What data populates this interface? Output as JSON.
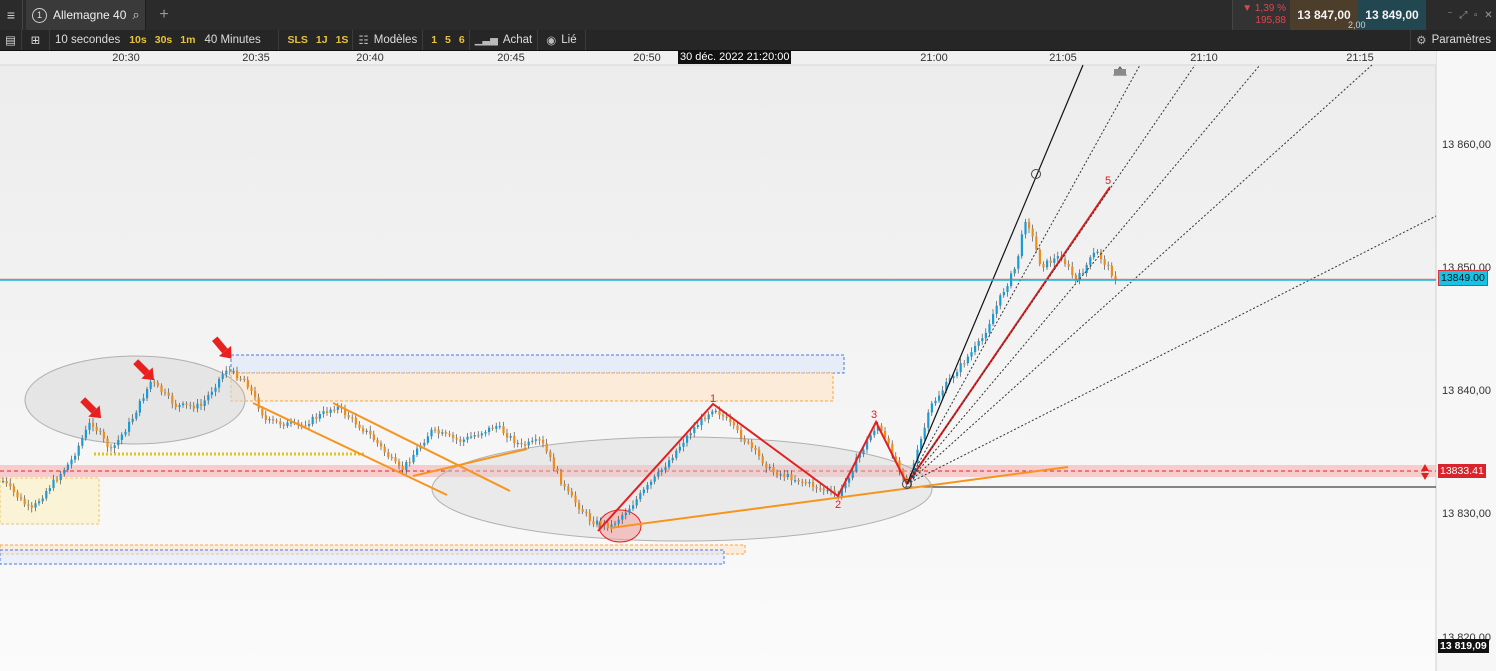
{
  "topbar": {
    "tab_number": "1",
    "instrument": "Allemagne 40",
    "change_pct": "▼ 1,39 %",
    "change_abs": "195,88",
    "bid": "13 847,00",
    "ask": "13 849,00",
    "spread": "2,00"
  },
  "toolbar": {
    "interval": "10 secondes",
    "quick_intervals": [
      "10s",
      "30s",
      "1m"
    ],
    "range": "40 Minutes",
    "quick_ranges": [
      "SLS",
      "1J",
      "1S"
    ],
    "models": "Modèles",
    "quick_models": [
      "1",
      "5",
      "6"
    ],
    "buy": "Achat",
    "linked": "Lié",
    "params": "Paramètres"
  },
  "chart": {
    "crosshair_time": "30 déc. 2022 21:20:00",
    "time_labels": [
      "20:30",
      "20:35",
      "20:40",
      "20:45",
      "20:50",
      "21:00",
      "21:05",
      "21:10",
      "21:15"
    ],
    "price_labels": [
      "13 860,00",
      "13 850,00",
      "13 840,00",
      "13 830,00",
      "13 820,00"
    ],
    "current_price_tag": "13849.00",
    "line_price_tag": "13833.41",
    "low_price_tag": "13 819,09",
    "wave_labels": [
      "1",
      "2",
      "3",
      "5"
    ],
    "colors": {
      "up": "#1a9ad6",
      "down": "#f08c1a",
      "annotation": "#f7941d",
      "wave": "#e32020",
      "current_line": "#18b4d6"
    }
  }
}
